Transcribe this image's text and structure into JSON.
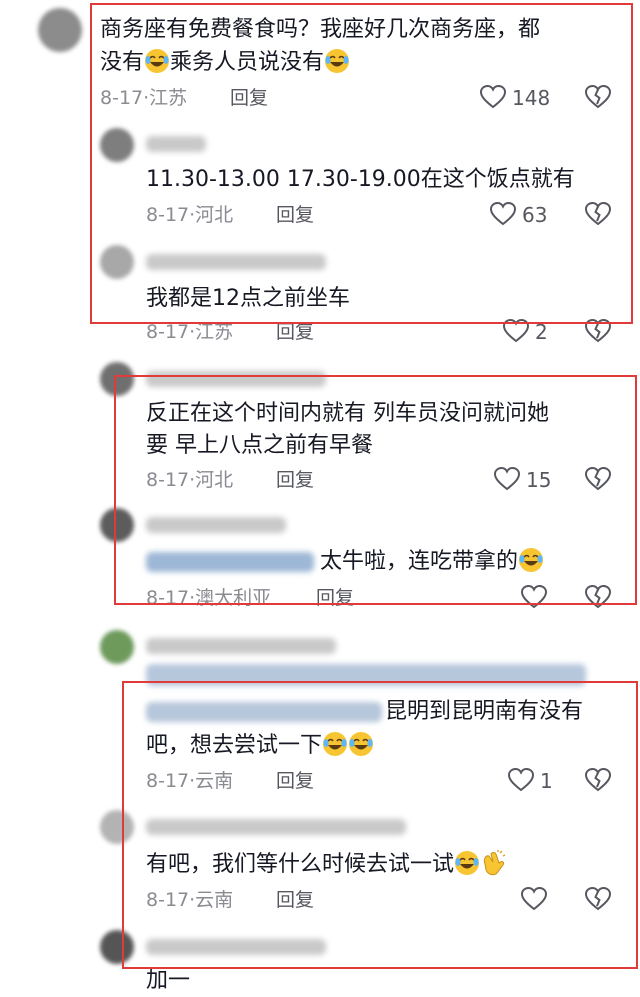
{
  "comments": [
    {
      "text_lines": [
        "商务座有免费餐食吗？我座好几次商务座，都",
        "没有",
        "乘务人员说没有"
      ],
      "emoji": "laughing-crying",
      "date": "8-17",
      "location": "江苏",
      "reply_label": "回复",
      "likes": "148"
    },
    {
      "text_lines": [
        "11.30-13.00  17.30-19.00在这个饭点就有"
      ],
      "date": "8-17",
      "location": "河北",
      "reply_label": "回复",
      "likes": "63"
    },
    {
      "text_lines": [
        "我都是12点之前坐车"
      ],
      "date": "8-17",
      "location": "江苏",
      "reply_label": "回复",
      "likes": "2"
    },
    {
      "text_lines": [
        "反正在这个时间内就有  列车员没问就问她",
        "要  早上八点之前有早餐"
      ],
      "date": "8-17",
      "location": "河北",
      "reply_label": "回复",
      "likes": "15"
    },
    {
      "text_lines": [
        "太牛啦，连吃带拿的"
      ],
      "emoji": "laughing-crying",
      "date": "8-17",
      "location": "澳大利亚",
      "reply_label": "回复",
      "likes": ""
    },
    {
      "text_lines": [
        "昆明到昆明南有没有",
        "吧，想去尝试一下"
      ],
      "emoji": "laughing-crying",
      "date": "8-17",
      "location": "云南",
      "reply_label": "回复",
      "likes": "1"
    },
    {
      "text_lines": [
        "有吧，我们等什么时候去试一试"
      ],
      "emoji": "laughing-crying",
      "date": "8-17",
      "location": "云南",
      "reply_label": "回复",
      "likes": ""
    },
    {
      "text_lines": [
        "加一"
      ]
    }
  ],
  "meta_separator": "·",
  "colors": {
    "highlight_box": "#e03a3a",
    "emoji_face": "#f7c531"
  },
  "icons": [
    "heart-outline-icon",
    "broken-heart-icon",
    "laughing-crying-emoji",
    "clapping-hands-emoji"
  ]
}
